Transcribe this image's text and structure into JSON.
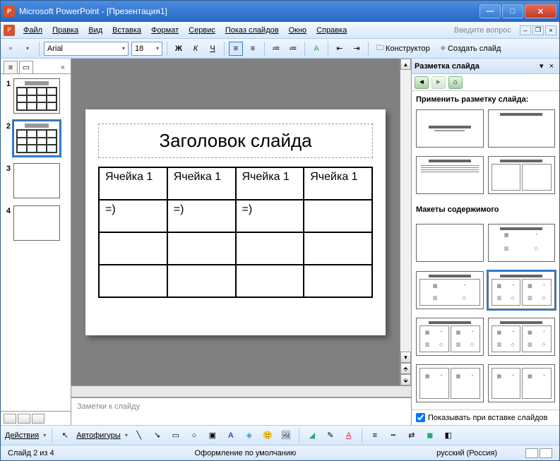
{
  "window": {
    "title": "Microsoft PowerPoint - [Презентация1]"
  },
  "menu": {
    "items": [
      "Файл",
      "Правка",
      "Вид",
      "Вставка",
      "Формат",
      "Сервис",
      "Показ слайдов",
      "Окно",
      "Справка"
    ],
    "question_placeholder": "Введите вопрос"
  },
  "toolbar": {
    "font": "Arial",
    "size": "18",
    "designer": "Конструктор",
    "new_slide": "Создать слайд"
  },
  "thumbnails": [
    {
      "num": "1",
      "selected": false,
      "has_table": true
    },
    {
      "num": "2",
      "selected": true,
      "has_table": true
    },
    {
      "num": "3",
      "selected": false,
      "has_table": false
    },
    {
      "num": "4",
      "selected": false,
      "has_table": false
    }
  ],
  "slide": {
    "title": "Заголовок слайда",
    "table": [
      [
        "Ячейка 1",
        "Ячейка 1",
        "Ячейка 1",
        "Ячейка 1"
      ],
      [
        "=)",
        "=)",
        "=)",
        ""
      ],
      [
        "",
        "",
        "",
        ""
      ],
      [
        "",
        "",
        "",
        ""
      ]
    ]
  },
  "notes": {
    "placeholder": "Заметки к слайду"
  },
  "taskpane": {
    "title": "Разметка слайда",
    "apply_label": "Применить разметку слайда:",
    "content_layouts_label": "Макеты содержимого",
    "show_on_insert": "Показывать при вставке слайдов",
    "show_checked": true
  },
  "bottombar": {
    "actions": "Действия",
    "autoshapes": "Автофигуры"
  },
  "status": {
    "slide": "Слайд 2 из 4",
    "design": "Оформление по умолчанию",
    "lang": "русский (Россия)"
  }
}
